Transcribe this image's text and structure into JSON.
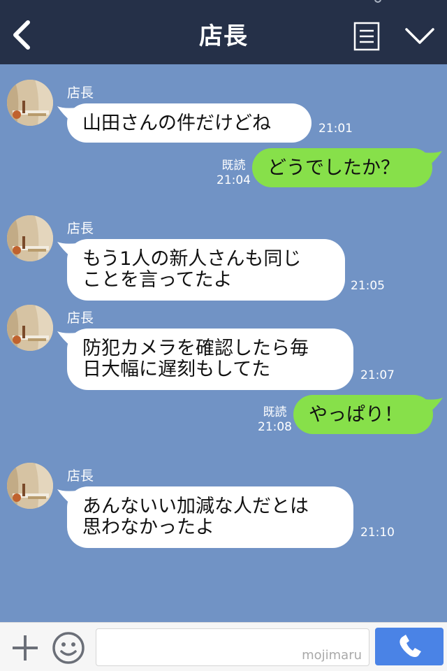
{
  "header": {
    "title": "店長",
    "icons": {
      "back": "chevron-left-icon",
      "menu": "document-menu-icon",
      "collapse": "chevron-down-icon"
    }
  },
  "messages": [
    {
      "direction": "in",
      "sender": "店長",
      "lines": [
        "山田さんの件だけどね"
      ],
      "time": "21:01"
    },
    {
      "direction": "out",
      "lines": [
        "どうでしたか？"
      ],
      "read": "既読",
      "time": "21:04"
    },
    {
      "direction": "in",
      "sender": "店長",
      "lines": [
        "もう1人の新人さんも同じ",
        "ことを言ってたよ"
      ],
      "time": "21:05"
    },
    {
      "direction": "in",
      "sender": "店長",
      "lines": [
        "防犯カメラを確認したら毎",
        "日大幅に遅刻もしてた"
      ],
      "time": "21:07"
    },
    {
      "direction": "out",
      "lines": [
        "やっぱり！"
      ],
      "read": "既読",
      "time": "21:08"
    },
    {
      "direction": "in",
      "sender": "店長",
      "lines": [
        "あんないい加減な人だとは",
        "思わなかったよ"
      ],
      "time": "21:10"
    }
  ],
  "footer": {
    "input_value": "",
    "watermark": "mojimaru",
    "icons": {
      "plus": "plus-icon",
      "emoji": "smiley-icon",
      "call": "phone-icon"
    }
  },
  "colors": {
    "header_bg": "#253048",
    "chat_bg": "#7193c5",
    "incoming_bubble": "#ffffff",
    "outgoing_bubble": "#87e04a",
    "call_button": "#4a83e6"
  }
}
